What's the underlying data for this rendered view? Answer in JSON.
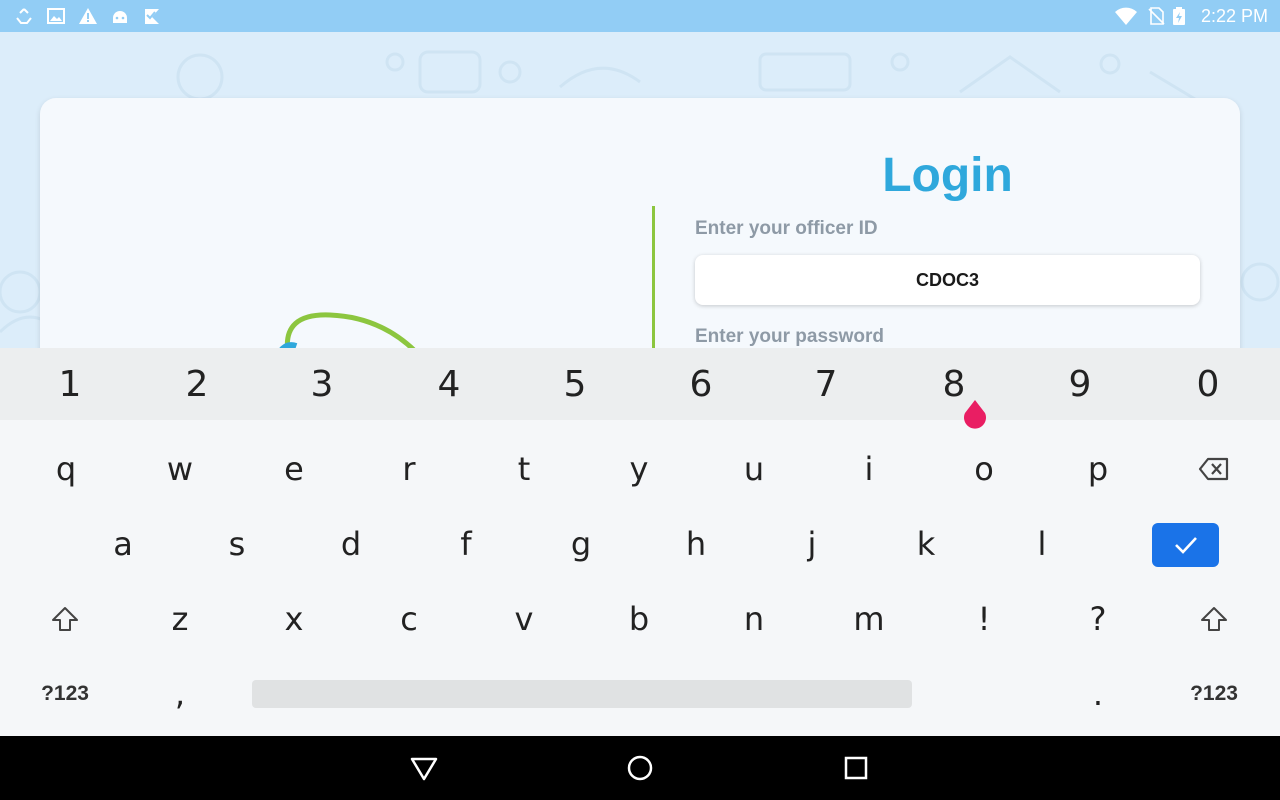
{
  "status_bar": {
    "time": "2:22 PM",
    "left_icons": [
      "sync-icon",
      "image-icon",
      "warning-icon",
      "android-icon",
      "check-flag-icon"
    ],
    "right_icons": [
      "wifi-icon",
      "no-sim-icon",
      "battery-charging-icon"
    ]
  },
  "login": {
    "title": "Login",
    "officer_label": "Enter your officer ID",
    "officer_value": "CDOC3",
    "password_label": "Enter your password"
  },
  "keyboard": {
    "numbers": [
      "1",
      "2",
      "3",
      "4",
      "5",
      "6",
      "7",
      "8",
      "9",
      "0"
    ],
    "row1": [
      "q",
      "w",
      "e",
      "r",
      "t",
      "y",
      "u",
      "i",
      "o",
      "p"
    ],
    "row2": [
      "a",
      "s",
      "d",
      "f",
      "g",
      "h",
      "j",
      "k",
      "l"
    ],
    "row3": [
      "z",
      "x",
      "c",
      "v",
      "b",
      "n",
      "m",
      "!",
      "?"
    ],
    "sym_left": "?123",
    "comma": ",",
    "period": ".",
    "sym_right": "?123"
  },
  "colors": {
    "accent": "#2fa8dc",
    "divider": "#8cc63f",
    "enter_key": "#1a73e8",
    "cursor_handle": "#e91e63"
  }
}
